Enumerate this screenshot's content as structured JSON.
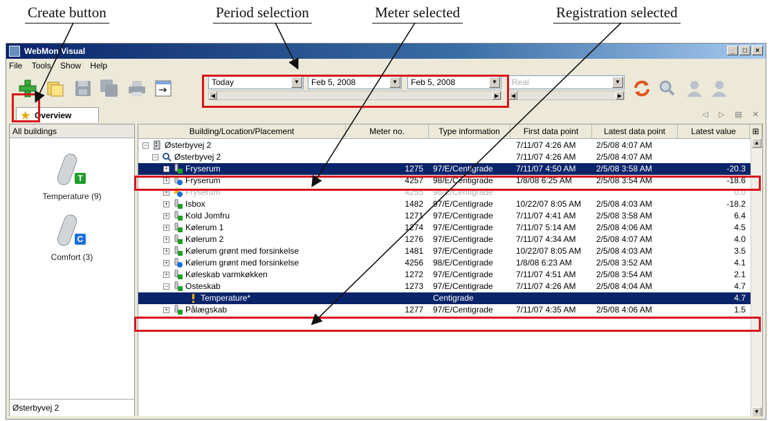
{
  "annotations": {
    "create_button": "Create button",
    "period_selection": "Period selection",
    "meter_selected": "Meter selected",
    "registration_selected": "Registration selected"
  },
  "window": {
    "title": "WebMon Visual",
    "buttons": [
      "_",
      "□",
      "×"
    ]
  },
  "menu": [
    "File",
    "Tools",
    "Show",
    "Help"
  ],
  "toolbar": {
    "period": "Today",
    "date_from": "Feb 5, 2008",
    "date_to": "Feb 5, 2008",
    "mode": "Real"
  },
  "tab": {
    "label": "Overview"
  },
  "left_panel": {
    "header": "All buildings",
    "items": [
      {
        "label": "Temperature (9)",
        "badge": "T",
        "badge_color": "#1f9d2a"
      },
      {
        "label": "Comfort (3)",
        "badge": "C",
        "badge_color": "#1d6fd8"
      }
    ],
    "footer": "Østerbyvej 2"
  },
  "columns": [
    "Building/Location/Placement",
    "Meter no.",
    "Type information",
    "First data point",
    "Latest data point",
    "Latest value"
  ],
  "rows": [
    {
      "name": "Østerbyvej 2",
      "meter": "",
      "type": "",
      "first": "7/11/07 4:26 AM",
      "latest": "2/5/08 4:07 AM",
      "value": ""
    },
    {
      "name": "Østerbyvej 2",
      "meter": "",
      "type": "",
      "first": "7/11/07 4:26 AM",
      "latest": "2/5/08 4:07 AM",
      "value": ""
    },
    {
      "name": "Fryserum",
      "meter": "1275",
      "type": "97/E/Centigrade",
      "first": "7/11/07 4:50 AM",
      "latest": "2/5/08 3:58 AM",
      "value": "-20.3"
    },
    {
      "name": "Fryserum",
      "meter": "4257",
      "type": "98/E/Centigrade",
      "first": "1/8/08 6:25 AM",
      "latest": "2/5/08 3:54 AM",
      "value": "-18.6"
    },
    {
      "name": "Fryserum",
      "meter": "4255",
      "type": "98/E/Centigrade",
      "first": "",
      "latest": "",
      "value": "0.0"
    },
    {
      "name": "Isbox",
      "meter": "1482",
      "type": "97/E/Centigrade",
      "first": "10/22/07 8:05 AM",
      "latest": "2/5/08 4:03 AM",
      "value": "-18.2"
    },
    {
      "name": "Kold Jomfru",
      "meter": "1271",
      "type": "97/E/Centigrade",
      "first": "7/11/07 4:41 AM",
      "latest": "2/5/08 3:58 AM",
      "value": "6.4"
    },
    {
      "name": "Kølerum 1",
      "meter": "1274",
      "type": "97/E/Centigrade",
      "first": "7/11/07 5:14 AM",
      "latest": "2/5/08 4:06 AM",
      "value": "4.5"
    },
    {
      "name": "Kølerum 2",
      "meter": "1276",
      "type": "97/E/Centigrade",
      "first": "7/11/07 4:34 AM",
      "latest": "2/5/08 4:07 AM",
      "value": "4.0"
    },
    {
      "name": "Kølerum grønt med forsinkelse",
      "meter": "1481",
      "type": "97/E/Centigrade",
      "first": "10/22/07 8:05 AM",
      "latest": "2/5/08 4:03 AM",
      "value": "3.5"
    },
    {
      "name": "Kølerum grønt med forsinkelse",
      "meter": "4256",
      "type": "98/E/Centigrade",
      "first": "1/8/08 6:23 AM",
      "latest": "2/5/08 3:52 AM",
      "value": "4.1"
    },
    {
      "name": "Køleskab varmkøkken",
      "meter": "1272",
      "type": "97/E/Centigrade",
      "first": "7/11/07 4:51 AM",
      "latest": "2/5/08 3:54 AM",
      "value": "2.1"
    },
    {
      "name": "Osteskab",
      "meter": "1273",
      "type": "97/E/Centigrade",
      "first": "7/11/07 4:26 AM",
      "latest": "2/5/08 4:04 AM",
      "value": "4.7"
    },
    {
      "name": "Temperature*",
      "meter": "",
      "type": "Centigrade",
      "first": "",
      "latest": "",
      "value": "4.7"
    },
    {
      "name": "Pålægskab",
      "meter": "1277",
      "type": "97/E/Centigrade",
      "first": "7/11/07 4:35 AM",
      "latest": "2/5/08 4:06 AM",
      "value": "1.5"
    }
  ]
}
